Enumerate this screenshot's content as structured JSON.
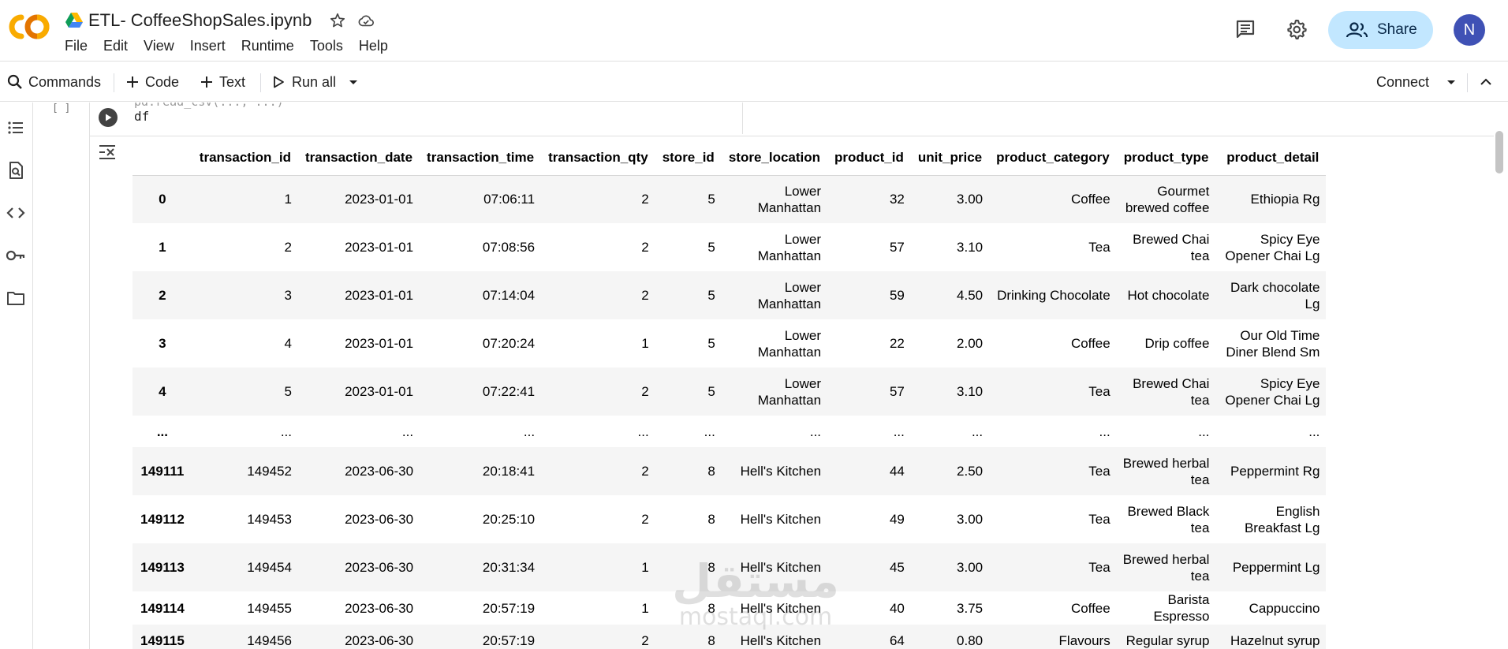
{
  "header": {
    "doc_title": "ETL- CoffeeShopSales.ipynb",
    "menu": [
      "File",
      "Edit",
      "View",
      "Insert",
      "Runtime",
      "Tools",
      "Help"
    ],
    "share_label": "Share",
    "avatar_initial": "N",
    "colors": {
      "accent": "#c2e7ff",
      "avatar": "#3f51b5",
      "logo_orange": "#f9ab00",
      "logo_dark": "#e37400"
    }
  },
  "toolbar": {
    "commands_label": "Commands",
    "code_label": "Code",
    "text_label": "Text",
    "run_all_label": "Run all",
    "connect_label": "Connect"
  },
  "siderail": {
    "icons": [
      "table-of-contents-icon",
      "find-replace-icon",
      "code-snippets-icon",
      "secrets-key-icon",
      "files-folder-icon"
    ]
  },
  "cell": {
    "exec_count": "[ ]",
    "code": "df",
    "code_above": "pd.read_csv(..., ...)"
  },
  "dataframe": {
    "columns": [
      "",
      "transaction_id",
      "transaction_date",
      "transaction_time",
      "transaction_qty",
      "store_id",
      "store_location",
      "product_id",
      "unit_price",
      "product_category",
      "product_type",
      "product_detail"
    ],
    "rows": [
      {
        "cells": [
          "0",
          "1",
          "2023-01-01",
          "07:06:11",
          "2",
          "5",
          "Lower Manhattan",
          "32",
          "3.00",
          "Coffee",
          "Gourmet brewed coffee",
          "Ethiopia Rg"
        ],
        "tall": true
      },
      {
        "cells": [
          "1",
          "2",
          "2023-01-01",
          "07:08:56",
          "2",
          "5",
          "Lower Manhattan",
          "57",
          "3.10",
          "Tea",
          "Brewed Chai tea",
          "Spicy Eye Opener Chai Lg"
        ],
        "tall": true
      },
      {
        "cells": [
          "2",
          "3",
          "2023-01-01",
          "07:14:04",
          "2",
          "5",
          "Lower Manhattan",
          "59",
          "4.50",
          "Drinking Chocolate",
          "Hot chocolate",
          "Dark chocolate Lg"
        ],
        "tall": true
      },
      {
        "cells": [
          "3",
          "4",
          "2023-01-01",
          "07:20:24",
          "1",
          "5",
          "Lower Manhattan",
          "22",
          "2.00",
          "Coffee",
          "Drip coffee",
          "Our Old Time Diner Blend Sm"
        ],
        "tall": true
      },
      {
        "cells": [
          "4",
          "5",
          "2023-01-01",
          "07:22:41",
          "2",
          "5",
          "Lower Manhattan",
          "57",
          "3.10",
          "Tea",
          "Brewed Chai tea",
          "Spicy Eye Opener Chai Lg"
        ],
        "tall": true
      },
      {
        "cells": [
          "...",
          "...",
          "...",
          "...",
          "...",
          "...",
          "...",
          "...",
          "...",
          "...",
          "...",
          "..."
        ],
        "tall": false
      },
      {
        "cells": [
          "149111",
          "149452",
          "2023-06-30",
          "20:18:41",
          "2",
          "8",
          "Hell's Kitchen",
          "44",
          "2.50",
          "Tea",
          "Brewed herbal tea",
          "Peppermint Rg"
        ],
        "tall": true
      },
      {
        "cells": [
          "149112",
          "149453",
          "2023-06-30",
          "20:25:10",
          "2",
          "8",
          "Hell's Kitchen",
          "49",
          "3.00",
          "Tea",
          "Brewed Black tea",
          "English Breakfast Lg"
        ],
        "tall": true
      },
      {
        "cells": [
          "149113",
          "149454",
          "2023-06-30",
          "20:31:34",
          "1",
          "8",
          "Hell's Kitchen",
          "45",
          "3.00",
          "Tea",
          "Brewed herbal tea",
          "Peppermint Lg"
        ],
        "tall": true
      },
      {
        "cells": [
          "149114",
          "149455",
          "2023-06-30",
          "20:57:19",
          "1",
          "8",
          "Hell's Kitchen",
          "40",
          "3.75",
          "Coffee",
          "Barista Espresso",
          "Cappuccino"
        ],
        "tall": false
      },
      {
        "cells": [
          "149115",
          "149456",
          "2023-06-30",
          "20:57:19",
          "2",
          "8",
          "Hell's Kitchen",
          "64",
          "0.80",
          "Flavours",
          "Regular syrup",
          "Hazelnut syrup"
        ],
        "tall": false
      }
    ]
  },
  "watermark": {
    "arabic": "مستقل",
    "latin": "mostaql.com"
  }
}
